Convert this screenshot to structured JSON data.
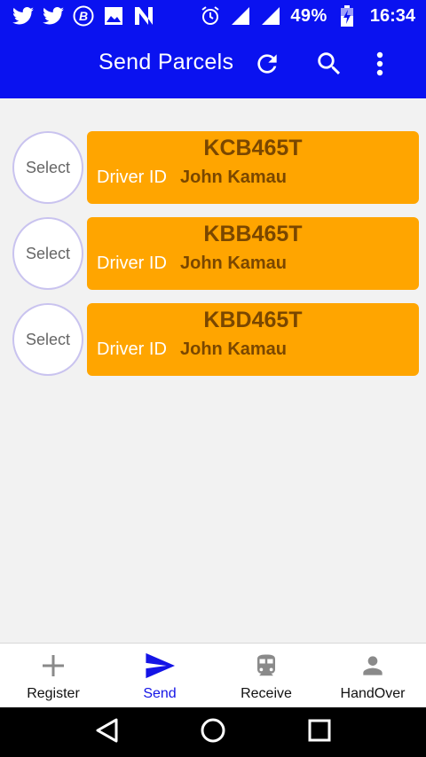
{
  "status_bar": {
    "icons_left": [
      "twitter-icon",
      "twitter-icon",
      "bitcoin-icon",
      "image-icon",
      "n-icon"
    ],
    "icons_right": [
      "alarm-icon",
      "signal-icon",
      "signal-icon"
    ],
    "battery": "49%",
    "time": "16:34"
  },
  "app_bar": {
    "title": "Send Parcels",
    "actions": [
      "refresh-icon",
      "search-icon",
      "more-vert-icon"
    ]
  },
  "vehicles": [
    {
      "select_label": "Select",
      "plate": "KCB465T",
      "driver_label": "Driver ID",
      "driver_name": "John Kamau"
    },
    {
      "select_label": "Select",
      "plate": "KBB465T",
      "driver_label": "Driver ID",
      "driver_name": "John Kamau"
    },
    {
      "select_label": "Select",
      "plate": "KBD465T",
      "driver_label": "Driver ID",
      "driver_name": "John Kamau"
    }
  ],
  "bottom_nav": {
    "items": [
      {
        "label": "Register",
        "icon": "plus-icon",
        "active": false
      },
      {
        "label": "Send",
        "icon": "send-icon",
        "active": true
      },
      {
        "label": "Receive",
        "icon": "train-icon",
        "active": false
      },
      {
        "label": "HandOver",
        "icon": "person-icon",
        "active": false
      }
    ]
  },
  "colors": {
    "primary": "#0a12f0",
    "card": "#ffa500",
    "card_text": "#7a4700",
    "active_nav": "#1414e6"
  }
}
